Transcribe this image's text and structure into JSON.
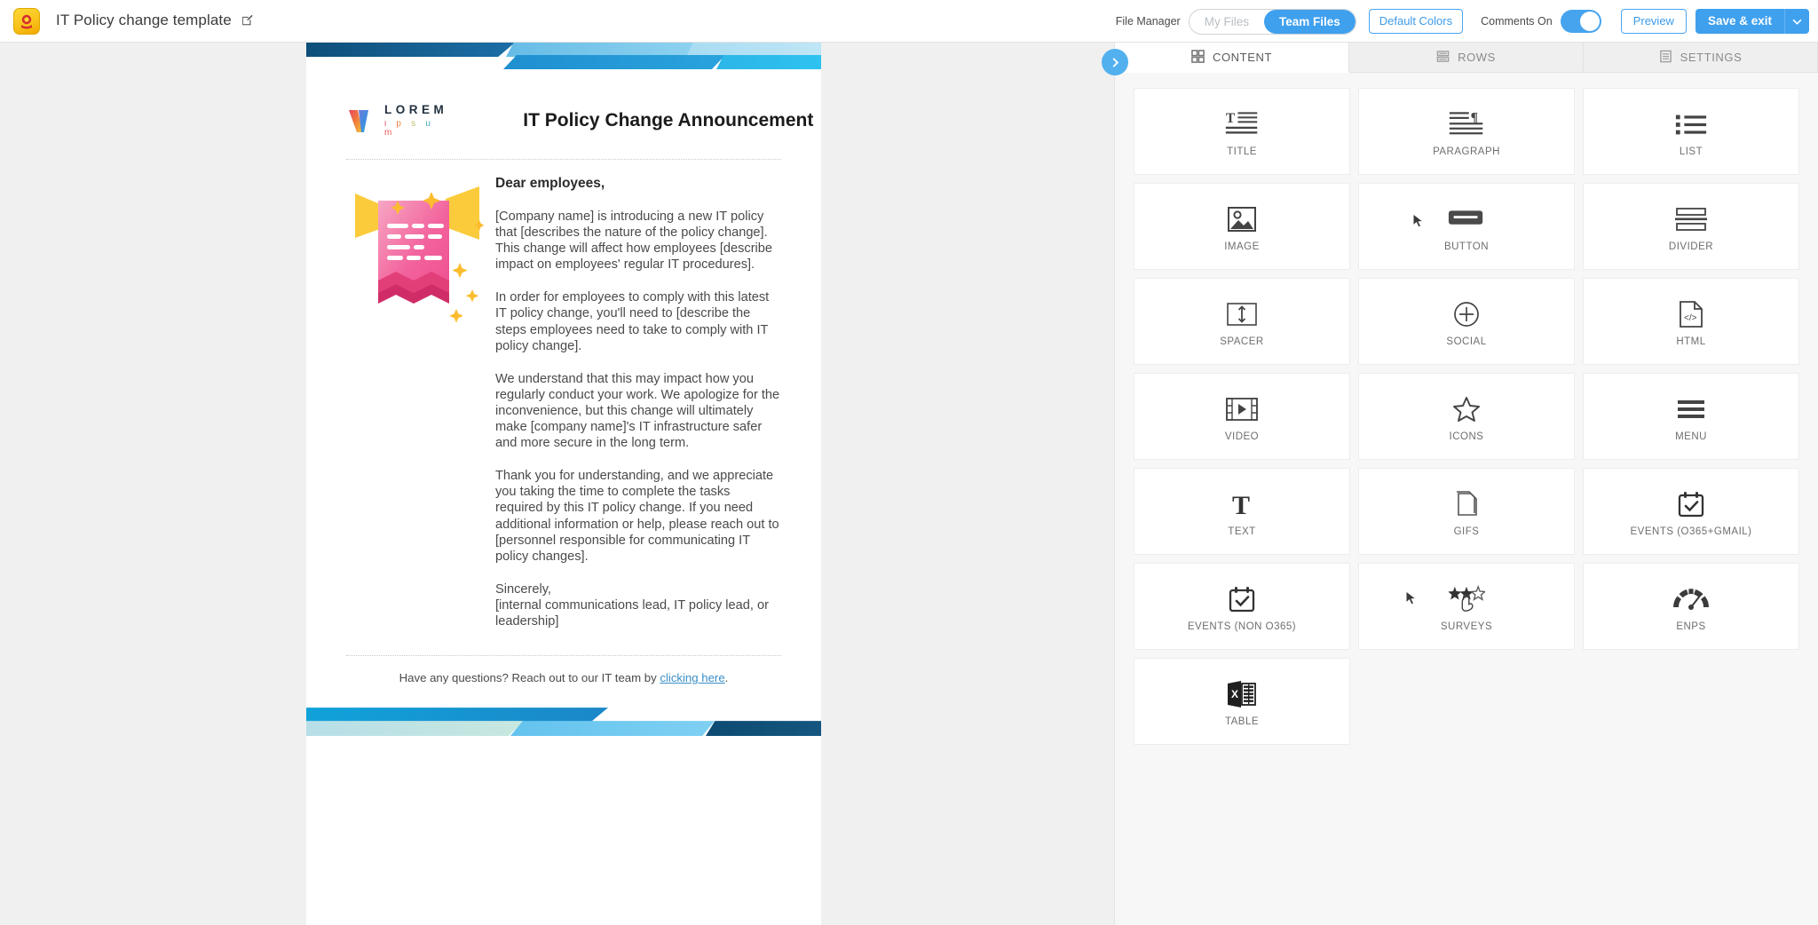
{
  "topbar": {
    "app_logo_icon": "app-badge-icon",
    "doc_title": "IT Policy change template",
    "edit_icon": "edit-pencil-icon",
    "file_manager_label": "File Manager",
    "file_tabs": [
      {
        "label": "My Files",
        "active": false
      },
      {
        "label": "Team Files",
        "active": true
      }
    ],
    "default_colors_label": "Default Colors",
    "comments_label": "Comments On",
    "comments_toggle_on": true,
    "preview_label": "Preview",
    "save_label": "Save & exit",
    "save_caret_icon": "chevron-down-icon",
    "accent_blue": "#3fa0ee"
  },
  "device_toggle": {
    "desktop_icon": "desktop-icon",
    "mobile_icon": "mobile-icon",
    "active": "desktop"
  },
  "email": {
    "logo_lorem": "LOREM",
    "logo_ipsum": "i p s u m",
    "title": "IT Policy Change Announcement",
    "illustration_icon": "announcement-megaphone-illustration",
    "salutation": "Dear employees,",
    "paragraphs": [
      "[Company name] is introducing a new IT policy that [describes the nature of the policy change]. This change will affect how employees [describe impact on employees' regular IT procedures].",
      "In order for employees to comply with this latest IT policy change, you'll need to [describe the steps employees need to take to comply with IT policy change].",
      "We understand that this may impact how you regularly conduct your work. We apologize for the inconvenience, but this change will ultimately make [company name]'s IT infrastructure safer and more secure in the long term.",
      "Thank you for understanding, and we appreciate you taking the time to complete the tasks required by this IT policy change. If you need additional information or help, please reach out to [personnel responsible for communicating IT policy changes]."
    ],
    "signoff": "Sincerely,\n[internal communications lead, IT policy lead, or leadership]",
    "footer_prefix": "Have any questions? Reach out to our IT team by ",
    "footer_link": "clicking here",
    "footer_suffix": "."
  },
  "panel": {
    "collapse_icon": "chevron-right-icon",
    "tabs": [
      {
        "label": "CONTENT",
        "icon": "grid-icon",
        "active": true
      },
      {
        "label": "ROWS",
        "icon": "rows-icon",
        "active": false
      },
      {
        "label": "SETTINGS",
        "icon": "settings-list-icon",
        "active": false
      }
    ],
    "tiles": [
      {
        "label": "TITLE",
        "icon": "title-icon"
      },
      {
        "label": "PARAGRAPH",
        "icon": "paragraph-icon"
      },
      {
        "label": "LIST",
        "icon": "list-icon"
      },
      {
        "label": "IMAGE",
        "icon": "image-icon"
      },
      {
        "label": "BUTTON",
        "icon": "button-icon"
      },
      {
        "label": "DIVIDER",
        "icon": "divider-icon"
      },
      {
        "label": "SPACER",
        "icon": "spacer-icon"
      },
      {
        "label": "SOCIAL",
        "icon": "social-plus-icon"
      },
      {
        "label": "HTML",
        "icon": "html-code-icon"
      },
      {
        "label": "VIDEO",
        "icon": "video-icon"
      },
      {
        "label": "ICONS",
        "icon": "star-icon"
      },
      {
        "label": "MENU",
        "icon": "hamburger-menu-icon"
      },
      {
        "label": "TEXT",
        "icon": "text-t-icon"
      },
      {
        "label": "GIFS",
        "icon": "gifs-page-icon"
      },
      {
        "label": "EVENTS (O365+GMAIL)",
        "icon": "calendar-check-icon"
      },
      {
        "label": "EVENTS (NON O365)",
        "icon": "calendar-check-icon"
      },
      {
        "label": "SURVEYS",
        "icon": "star-rating-icon"
      },
      {
        "label": "ENPS",
        "icon": "gauge-icon"
      },
      {
        "label": "TABLE",
        "icon": "excel-table-icon"
      }
    ]
  }
}
